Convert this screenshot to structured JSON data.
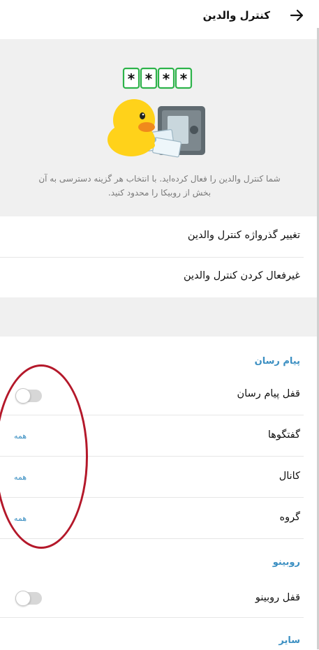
{
  "header": {
    "title": "کنترل والدین",
    "back_icon": "arrow-right-icon"
  },
  "hero": {
    "password_chars": [
      "*",
      "*",
      "*",
      "*"
    ],
    "description_line1": "شما کنترل والدین را فعال کرده‌اید. با انتخاب هر گزینه دسترسی به آن",
    "description_line2": "بخش از روبیکا را محدود کنید."
  },
  "options": {
    "change_password": "تغییر گذرواژه کنترل والدین",
    "disable": "غیرفعال کردن کنترل والدین"
  },
  "messenger": {
    "section_title": "پیام رسان",
    "lock_label": "قفل پیام رسان",
    "lock_enabled": false,
    "chats_label": "گفتگوها",
    "chats_value": "همه",
    "channel_label": "کانال",
    "channel_value": "همه",
    "group_label": "گروه",
    "group_value": "همه"
  },
  "rubino": {
    "section_title": "روبینو",
    "lock_label": "قفل روبینو",
    "lock_enabled": false
  },
  "other": {
    "section_title": "سایر"
  },
  "colors": {
    "accent": "#3b8fc2",
    "annotation": "#b4182a",
    "background_gray": "#f0f0f0"
  }
}
